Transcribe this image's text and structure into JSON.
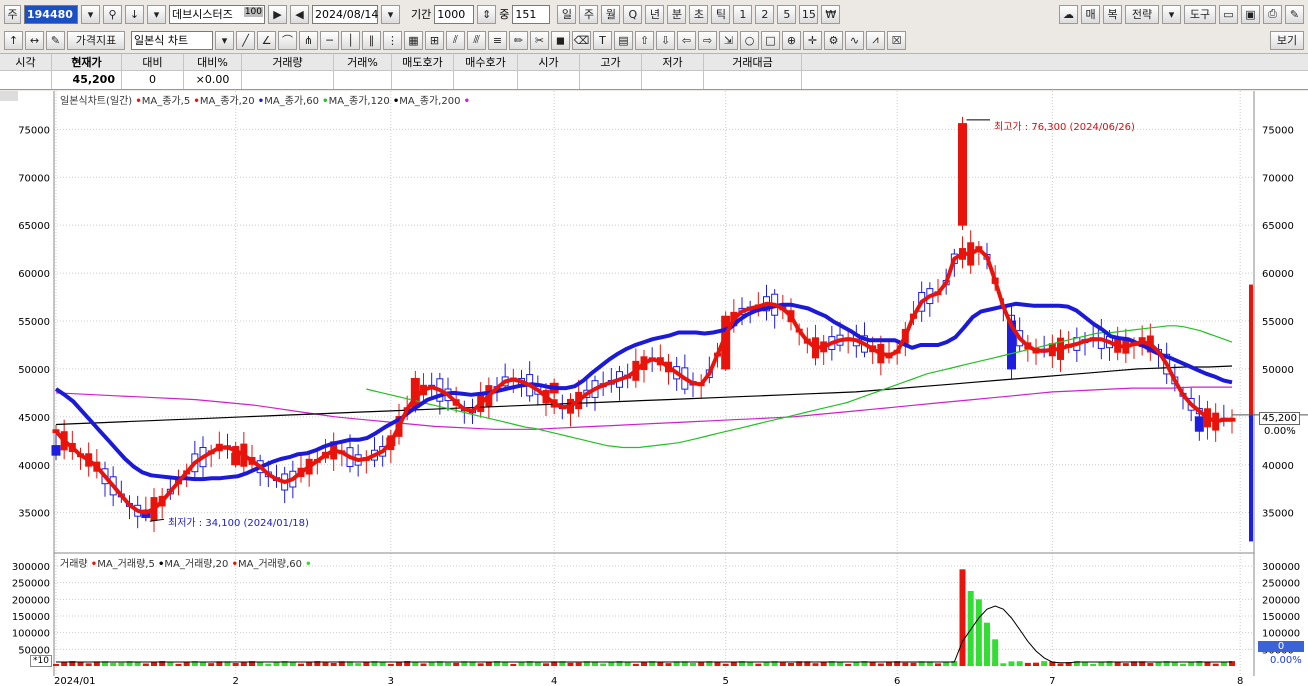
{
  "toolbar": {
    "market_label": "주",
    "code": "194480",
    "name": "데브시스터즈",
    "name_badge": "100",
    "date": "2024/08/14",
    "period_label": "기간",
    "period_value": "1000",
    "middle_label": "중",
    "middle_value": "151",
    "timeframes": [
      "일",
      "주",
      "월",
      "Q",
      "년",
      "분",
      "초",
      "틱",
      "1",
      "2",
      "5",
      "15",
      "₩"
    ],
    "active_timeframe": "일",
    "right_buttons": [
      "매",
      "복",
      "전략",
      "도구"
    ],
    "price_index_label": "가격지표",
    "chart_type_label": "일본식 차트",
    "view_label": "보기"
  },
  "quote": {
    "headers": [
      "시각",
      "현재가",
      "대비",
      "대비%",
      "거래량",
      "거래%",
      "매도호가",
      "매수호가",
      "시가",
      "고가",
      "저가",
      "거래대금"
    ],
    "values": [
      "",
      "45,200",
      "0",
      "0.00",
      "",
      "",
      "",
      "",
      "",
      "",
      "",
      ""
    ],
    "change_pct_icon": "flat-mark-icon"
  },
  "colors": {
    "up": "#e8140c",
    "down": "#1e1ee0",
    "ma5": "#e8140c",
    "ma20": "#1a1ad8",
    "ma60": "#22c222",
    "ma120": "#000000",
    "ma200": "#cc22cc",
    "volume_up": "#e8140c",
    "volume_down": "#33dd33"
  },
  "chart_data": {
    "type": "line",
    "price_legend": "일본식차트(일간)",
    "price_series_labels": [
      "MA_종가,5",
      "MA_종가,20",
      "MA_종가,60",
      "MA_종가,120",
      "MA_종가,200"
    ],
    "volume_legend": "거래량",
    "volume_series_labels": [
      "MA_거래량,5",
      "MA_거래량,20",
      "MA_거래량,60"
    ],
    "x_labels": [
      "2024/01",
      "2",
      "3",
      "4",
      "5",
      "6",
      "7",
      "8"
    ],
    "price_ticks": [
      35000,
      40000,
      45000,
      50000,
      55000,
      60000,
      65000,
      70000,
      75000
    ],
    "price_ylim": [
      31000,
      79000
    ],
    "volume_ticks": [
      50000,
      100000,
      150000,
      200000,
      250000,
      300000
    ],
    "volume_ylim": [
      0,
      300000
    ],
    "volume_unit_label": "*10",
    "high_annotation": "최고가 : 76,300 (2024/06/26)",
    "low_annotation": "최저가 : 34,100 (2024/01/18)",
    "current_price_label": "45,200",
    "current_change_label": "0.00%",
    "volume_current_label": "0",
    "volume_change_label": "0.00%",
    "month_start_index": [
      0,
      22,
      41,
      61,
      82,
      103,
      122,
      145
    ],
    "ma5": [
      43500,
      42500,
      41800,
      41000,
      40500,
      39800,
      38800,
      37800,
      36800,
      35800,
      35200,
      35000,
      35400,
      36200,
      37200,
      38200,
      39200,
      40200,
      40800,
      41300,
      41800,
      41800,
      41500,
      41000,
      40400,
      39800,
      39000,
      38500,
      38200,
      38500,
      39200,
      39800,
      40400,
      41000,
      41500,
      41300,
      40800,
      40500,
      40600,
      41000,
      41400,
      42300,
      44000,
      45800,
      47000,
      47800,
      48100,
      47800,
      47300,
      46500,
      45800,
      45600,
      46400,
      47200,
      48000,
      48700,
      48900,
      48700,
      48300,
      47800,
      47100,
      46400,
      46000,
      46100,
      46700,
      47400,
      47900,
      48300,
      48600,
      48900,
      49200,
      49800,
      50600,
      51000,
      50800,
      50200,
      49600,
      49000,
      48500,
      48400,
      49500,
      51500,
      53500,
      55200,
      56000,
      56300,
      56500,
      56800,
      56700,
      56300,
      55500,
      54000,
      52900,
      52200,
      52300,
      52700,
      53000,
      53100,
      53000,
      52600,
      52100,
      51600,
      51400,
      51800,
      53400,
      55500,
      57000,
      57600,
      57900,
      59000,
      61500,
      62000,
      62000,
      62500,
      61700,
      59200,
      56500,
      54500,
      53200,
      52400,
      51900,
      51900,
      52000,
      52100,
      52400,
      52600,
      52900,
      53100,
      53100,
      52800,
      52400,
      52300,
      52600,
      52800,
      52600,
      51800,
      50500,
      48800,
      47300,
      46300,
      45600,
      44900,
      44500,
      44700,
      44700
    ],
    "ma20": [
      47900,
      47300,
      46600,
      45600,
      44600,
      43600,
      42600,
      41600,
      40600,
      39800,
      39200,
      38900,
      38800,
      38700,
      38600,
      38600,
      38500,
      38500,
      38600,
      38600,
      38700,
      38800,
      39100,
      39500,
      39900,
      40300,
      40600,
      40800,
      41100,
      41200,
      41500,
      41900,
      42200,
      42400,
      42600,
      42600,
      42800,
      43300,
      43900,
      44400,
      44900,
      45600,
      46200,
      46800,
      47100,
      47400,
      47500,
      47400,
      47300,
      47400,
      47500,
      47700,
      47900,
      48100,
      48300,
      48400,
      48300,
      48100,
      48000,
      48000,
      48200,
      48800,
      49600,
      50300,
      51000,
      51600,
      52100,
      52500,
      52800,
      53100,
      53300,
      53500,
      53800,
      53800,
      53800,
      53700,
      53800,
      54000,
      54300,
      55100,
      55700,
      56100,
      56300,
      56500,
      56700,
      56700,
      56500,
      56300,
      55900,
      55500,
      54900,
      54400,
      53900,
      53300,
      53000,
      53000,
      53000,
      53000,
      52600,
      52200,
      52500,
      52500,
      52500,
      52800,
      53300,
      54300,
      55400,
      56000,
      56200,
      56400,
      56600,
      56800,
      56700,
      56600,
      56600,
      56600,
      56600,
      56500,
      56100,
      55400,
      54700,
      54100,
      53400,
      53200,
      53100,
      52700,
      52300,
      51800,
      51400,
      51100,
      50700,
      50300,
      49900,
      49500,
      49200,
      48800,
      48600
    ],
    "ma60": [
      47900,
      47700,
      47500,
      47300,
      47100,
      46900,
      46700,
      46500,
      46300,
      46100,
      45900,
      45700,
      45500,
      45300,
      45100,
      44900,
      44700,
      44500,
      44300,
      44100,
      43900,
      43800,
      43600,
      43400,
      43200,
      43000,
      42800,
      42600,
      42400,
      42200,
      42000,
      41900,
      41800,
      41800,
      41800,
      41900,
      42000,
      42100,
      42200,
      42300,
      42500,
      42700,
      42900,
      43100,
      43300,
      43500,
      43700,
      43900,
      44100,
      44300,
      44500,
      44700,
      44900,
      45100,
      45300,
      45500,
      45700,
      45900,
      46100,
      46300,
      46500,
      46800,
      47100,
      47400,
      47700,
      48000,
      48300,
      48600,
      48900,
      49200,
      49500,
      49700,
      49900,
      50100,
      50300,
      50500,
      50700,
      50900,
      51100,
      51300,
      51500,
      51700,
      51900,
      52100,
      52300,
      52500,
      52700,
      52900,
      53100,
      53300,
      53500,
      53700,
      53800,
      53800,
      53900,
      54000,
      54100,
      54200,
      54300,
      54400,
      54500,
      54500,
      54400,
      54200,
      54000,
      53700,
      53400,
      53100,
      52800
    ],
    "ma120": [
      44200,
      44300,
      44400,
      44500,
      44600,
      44700,
      44800,
      44900,
      45000,
      45100,
      45200,
      45300,
      45400,
      45500,
      45600,
      45700,
      45800,
      45900,
      46000,
      46100,
      46200,
      46300,
      46400,
      46500,
      46600,
      46700,
      46800,
      46900,
      47000,
      47100,
      47200,
      47300,
      47400,
      47500,
      47600,
      47800,
      48000,
      48200,
      48400,
      48600,
      48800,
      49000,
      49200,
      49400,
      49600,
      49800,
      50000,
      50100,
      50200,
      50200,
      50300
    ],
    "ma200": [
      47500,
      47400,
      47300,
      47200,
      47100,
      47000,
      46900,
      46800,
      46600,
      46400,
      46200,
      45900,
      45600,
      45300,
      45000,
      44800,
      44600,
      44400,
      44200,
      44000,
      43900,
      43800,
      43700,
      43700,
      43700,
      43800,
      43900,
      44000,
      44100,
      44200,
      44300,
      44400,
      44500,
      44600,
      44700,
      44800,
      44900,
      45000,
      45200,
      45400,
      45600,
      45800,
      46000,
      46200,
      46400,
      46600,
      46800,
      47000,
      47200,
      47400,
      47600,
      47700,
      47800,
      47900,
      48000,
      48000,
      48000,
      48100,
      48100,
      48100
    ],
    "candles_ohlc_sample": [
      [
        0,
        42000,
        43500,
        40500,
        41000
      ],
      [
        11,
        35000,
        35400,
        34100,
        34500
      ],
      [
        22,
        40000,
        41600,
        39800,
        41200
      ],
      [
        41,
        42000,
        43000,
        41800,
        42800
      ],
      [
        44,
        46000,
        49800,
        45800,
        49000
      ],
      [
        61,
        47500,
        49000,
        47000,
        48500
      ],
      [
        82,
        50000,
        56000,
        49800,
        55500
      ],
      [
        111,
        65000,
        76300,
        64500,
        75600
      ],
      [
        117,
        55000,
        56000,
        49000,
        50000
      ],
      [
        140,
        45000,
        46000,
        42500,
        43500
      ],
      [
        148,
        44800,
        45400,
        44600,
        45200
      ]
    ],
    "volume_ma20_peak": 180000,
    "volume_max": 290000
  }
}
